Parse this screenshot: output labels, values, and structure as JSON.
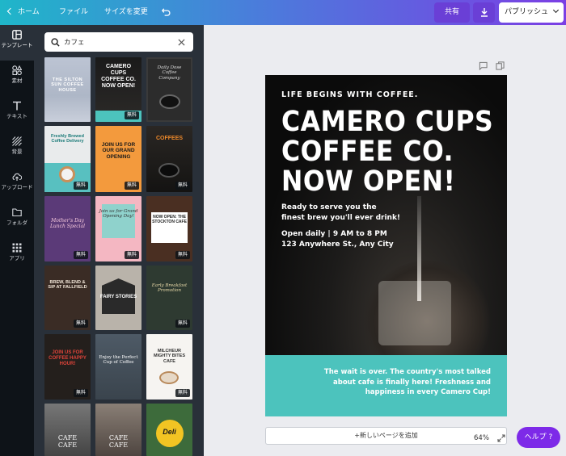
{
  "topbar": {
    "home_label": "ホーム",
    "file_label": "ファイル",
    "resize_label": "サイズを変更",
    "share_label": "共有",
    "publish_label": "パブリッシュ",
    "colors": {
      "share_bg": "#6a3fd6",
      "publish_bg": "#ffffff"
    }
  },
  "rail": {
    "items": [
      {
        "label": "テンプレート",
        "icon": "template-icon"
      },
      {
        "label": "素材",
        "icon": "elements-icon"
      },
      {
        "label": "テキスト",
        "icon": "text-icon"
      },
      {
        "label": "背景",
        "icon": "background-icon"
      },
      {
        "label": "アップロード",
        "icon": "upload-icon"
      },
      {
        "label": "フォルダ",
        "icon": "folder-icon"
      },
      {
        "label": "アプリ",
        "icon": "apps-icon"
      }
    ]
  },
  "search": {
    "value": "カフェ"
  },
  "templates": {
    "badge_label": "無料",
    "texts": {
      "t1": "THE SILTON SUN COFFEE HOUSE",
      "t2": "CAMERO CUPS COFFEE CO. NOW OPEN!",
      "t3": "Daily Dose Coffee Company",
      "t4": "Freshly Brewed Coffee Delivery",
      "t5": "JOIN US FOR OUR GRAND OPENING",
      "t6": "COFFEES",
      "t7": "Mother's Day Lunch Special",
      "t8": "Join us for Grand Opening Day!",
      "t9": "NOW OPEN: THE STOCKTON CAFE",
      "t10": "BREW, BLEND & SIP AT FALLFIELD",
      "t11": "FAIRY STORIES",
      "t12": "Early Breakfast Promotion",
      "t13": "JOIN US FOR COFFEE HAPPY HOUR!",
      "t14": "Enjoy the Perfect Cup of Coffee",
      "t15": "MILCHEUR MIGHTY BITES CAFE",
      "t16": "CAFE CAFE",
      "t17": "CAFE CAFE",
      "t18": "Deli"
    }
  },
  "poster": {
    "tagline": "LIFE BEGINS WITH COFFEE.",
    "headline": [
      "CAMERO CUPS",
      "COFFEE CO.",
      "NOW OPEN!"
    ],
    "sub": [
      "Ready to serve you the",
      "finest brew you'll ever drink!"
    ],
    "hours": [
      "Open daily | 9 AM to 8 PM",
      "123 Anywhere St., Any City"
    ],
    "footer": [
      "The wait is over. The country's most talked",
      "about cafe is finally here! Freshness and",
      "happiness in every Camero Cup!"
    ],
    "colors": {
      "footer_bg": "#4cc3bd"
    }
  },
  "canvas": {
    "add_page_label": "+新しいページを追加",
    "zoom_label": "64%"
  },
  "help": {
    "label": "ヘルプ ?"
  }
}
